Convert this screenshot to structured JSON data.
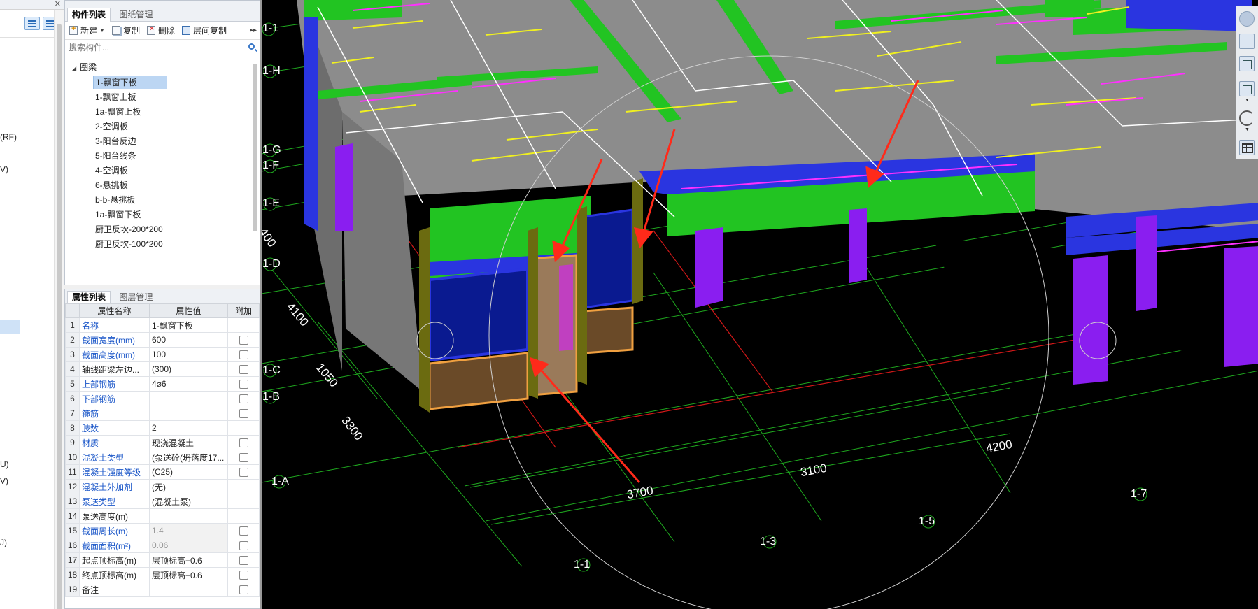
{
  "nav_panel": {
    "labels": [
      "(RF)",
      "V)",
      "U)",
      "V)",
      "J)"
    ]
  },
  "component_panel": {
    "tabs": [
      "构件列表",
      "图纸管理"
    ],
    "toolbar": {
      "new_label": "新建",
      "copy_label": "复制",
      "delete_label": "删除",
      "floor_copy_label": "层间复制"
    },
    "search_placeholder": "搜索构件...",
    "tree_root": "圈梁",
    "items": [
      "1-飘窗下板",
      "1-飘窗上板",
      "1a-飘窗上板",
      "2-空调板",
      "3-阳台反边",
      "5-阳台线条",
      "4-空调板",
      "6-悬挑板",
      "b-b-悬挑板",
      "1a-飘窗下板",
      "厨卫反坎-200*200",
      "厨卫反坎-100*200"
    ],
    "selected_index": 0
  },
  "property_panel": {
    "tabs": [
      "属性列表",
      "图层管理"
    ],
    "headers": [
      "属性名称",
      "属性值",
      "附加"
    ],
    "rows": [
      {
        "n": "1",
        "name": "名称",
        "value": "1-飘窗下板",
        "blue": true,
        "check": false,
        "ro": false
      },
      {
        "n": "2",
        "name": "截面宽度(mm)",
        "value": "600",
        "blue": true,
        "check": true,
        "ro": false
      },
      {
        "n": "3",
        "name": "截面高度(mm)",
        "value": "100",
        "blue": true,
        "check": true,
        "ro": false
      },
      {
        "n": "4",
        "name": "轴线距梁左边...",
        "value": "(300)",
        "blue": false,
        "check": true,
        "ro": false
      },
      {
        "n": "5",
        "name": "上部钢筋",
        "value": "4⌀6",
        "blue": true,
        "check": true,
        "ro": false
      },
      {
        "n": "6",
        "name": "下部钢筋",
        "value": "",
        "blue": true,
        "check": true,
        "ro": false
      },
      {
        "n": "7",
        "name": "箍筋",
        "value": "",
        "blue": true,
        "check": true,
        "ro": false
      },
      {
        "n": "8",
        "name": "肢数",
        "value": "2",
        "blue": true,
        "check": false,
        "ro": false
      },
      {
        "n": "9",
        "name": "材质",
        "value": "现浇混凝土",
        "blue": true,
        "check": true,
        "ro": false
      },
      {
        "n": "10",
        "name": "混凝土类型",
        "value": "(泵送砼(坍落度17...",
        "blue": true,
        "check": true,
        "ro": false
      },
      {
        "n": "11",
        "name": "混凝土强度等级",
        "value": "(C25)",
        "blue": true,
        "check": true,
        "ro": false
      },
      {
        "n": "12",
        "name": "混凝土外加剂",
        "value": "(无)",
        "blue": true,
        "check": false,
        "ro": false
      },
      {
        "n": "13",
        "name": "泵送类型",
        "value": "(混凝土泵)",
        "blue": true,
        "check": false,
        "ro": false
      },
      {
        "n": "14",
        "name": "泵送高度(m)",
        "value": "",
        "blue": false,
        "check": false,
        "ro": false
      },
      {
        "n": "15",
        "name": "截面周长(m)",
        "value": "1.4",
        "blue": true,
        "check": true,
        "ro": true
      },
      {
        "n": "16",
        "name": "截面面积(m²)",
        "value": "0.06",
        "blue": true,
        "check": true,
        "ro": true
      },
      {
        "n": "17",
        "name": "起点顶标高(m)",
        "value": "层顶标高+0.6",
        "blue": false,
        "check": true,
        "ro": false
      },
      {
        "n": "18",
        "name": "终点顶标高(m)",
        "value": "层顶标高+0.6",
        "blue": false,
        "check": true,
        "ro": false
      },
      {
        "n": "19",
        "name": "备注",
        "value": "",
        "blue": false,
        "check": true,
        "ro": false
      }
    ]
  },
  "viewport": {
    "axis_labels_left": [
      "1-1",
      "1-H",
      "1-G",
      "1-F",
      "1-E",
      "1-D",
      "1-C",
      "1-B",
      "1-A"
    ],
    "axis_labels_bottom": [
      "1-1",
      "1-3",
      "1-5",
      "1-7"
    ],
    "dimensions": [
      "400",
      "4100",
      "1050",
      "3300",
      "3700",
      "3100",
      "4200"
    ],
    "colors": {
      "background": "#000000",
      "slab": "#8c8c8c",
      "beam_green": "#22c422",
      "beam_blue": "#2a35e0",
      "column_purple": "#8a1ef0",
      "window_orange": "#f0a040",
      "arrow_red": "#ff2a1a",
      "grid_green": "#1faa1f",
      "grid_red": "#d01818",
      "rebar_yellow": "#f0f020",
      "rebar_magenta": "#ff30ff"
    }
  }
}
